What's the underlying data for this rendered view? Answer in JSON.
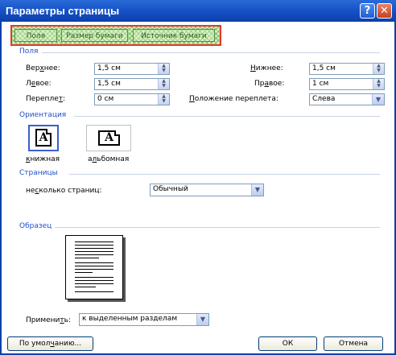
{
  "window": {
    "title": "Параметры страницы",
    "help_glyph": "?",
    "close_glyph": "✕"
  },
  "tabs": [
    {
      "label": "Поля",
      "active": true
    },
    {
      "label": "Размер бумаги",
      "active": false
    },
    {
      "label": "Источник бумаги",
      "active": false
    }
  ],
  "margins": {
    "group_label": "Поля",
    "top": {
      "label_pre": "Вер",
      "label_u": "х",
      "label_post": "нее:",
      "value": "1,5 см"
    },
    "bottom": {
      "label_pre": "",
      "label_u": "Н",
      "label_post": "ижнее:",
      "value": "1,5 см"
    },
    "left": {
      "label_pre": "Л",
      "label_u": "е",
      "label_post": "вое:",
      "value": "1,5 см"
    },
    "right": {
      "label_pre": "Пр",
      "label_u": "а",
      "label_post": "вое:",
      "value": "1 см"
    },
    "gutter": {
      "label_pre": "Перепле",
      "label_u": "т",
      "label_post": ":",
      "value": "0 см"
    },
    "gutter_position": {
      "label_pre": "",
      "label_u": "П",
      "label_post": "оложение переплета:",
      "value": "Слева"
    }
  },
  "orientation": {
    "group_label": "Ориентация",
    "portrait": {
      "label_pre": "",
      "label_u": "к",
      "label_post": "нижная",
      "icon_letter": "A",
      "selected": true
    },
    "landscape": {
      "label_pre": "а",
      "label_u": "л",
      "label_post": "ьбомная",
      "icon_letter": "A",
      "selected": false
    }
  },
  "pages": {
    "group_label": "Страницы",
    "multiple": {
      "label_pre": "не",
      "label_u": "с",
      "label_post": "колько страниц:",
      "value": "Обычный"
    }
  },
  "preview": {
    "group_label": "Образец"
  },
  "apply": {
    "label_pre": "Примени",
    "label_u": "т",
    "label_post": "ь:",
    "value": "к выделенным разделам"
  },
  "buttons": {
    "default": {
      "label_pre": "По умол",
      "label_u": "ч",
      "label_post": "анию..."
    },
    "ok": "ОК",
    "cancel": "Отмена"
  },
  "icons": {
    "spin": "spin-arrows-icon",
    "dropdown": "chevron-down-icon",
    "help": "help-icon",
    "close": "close-icon"
  },
  "colors": {
    "title_bar": "#1450c4",
    "group_label": "#1f4fc8",
    "tab_highlight_border": "#e03a2a",
    "tab_highlight_fill": "#d8f0b8"
  }
}
